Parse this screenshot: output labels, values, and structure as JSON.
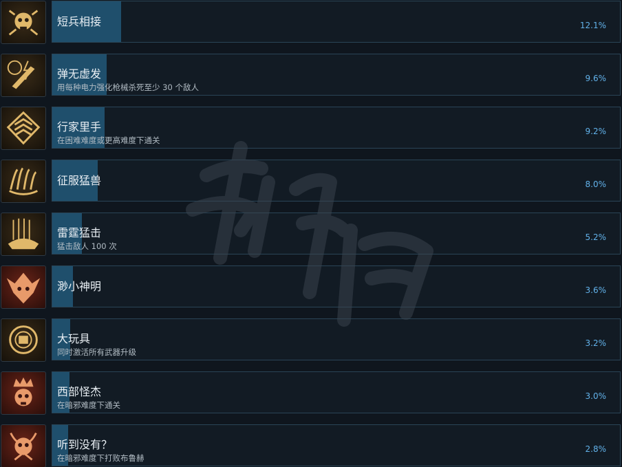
{
  "achievements": [
    {
      "title": "短兵相接",
      "desc": "",
      "percent": "12.1%",
      "fill": 12.1,
      "icon": "skull-crest-icon",
      "theme": "gold"
    },
    {
      "title": "弹无虚发",
      "desc": "用每种电力强化枪械杀死至少 30 个敌人",
      "percent": "9.6%",
      "fill": 9.6,
      "icon": "bullet-lightning-icon",
      "theme": "gold"
    },
    {
      "title": "行家里手",
      "desc": "在困难难度或更高难度下通关",
      "percent": "9.2%",
      "fill": 9.2,
      "icon": "rank-chevron-icon",
      "theme": "gold"
    },
    {
      "title": "征服猛兽",
      "desc": "",
      "percent": "8.0%",
      "fill": 8.0,
      "icon": "beast-claw-icon",
      "theme": "gold"
    },
    {
      "title": "雷霆猛击",
      "desc": "猛击敌人 100 次",
      "percent": "5.2%",
      "fill": 5.2,
      "icon": "thunder-fist-icon",
      "theme": "gold"
    },
    {
      "title": "渺小神明",
      "desc": "",
      "percent": "3.6%",
      "fill": 3.6,
      "icon": "demon-mask-icon",
      "theme": "red"
    },
    {
      "title": "大玩具",
      "desc": "同时激活所有武器升级",
      "percent": "3.2%",
      "fill": 3.2,
      "icon": "weapon-gear-icon",
      "theme": "gold"
    },
    {
      "title": "西部怪杰",
      "desc": "在暗邪难度下通关",
      "percent": "3.0%",
      "fill": 3.0,
      "icon": "crowned-skull-icon",
      "theme": "red"
    },
    {
      "title": "听到没有？",
      "desc": "在暗邪难度下打败布鲁赫",
      "percent": "2.8%",
      "fill": 2.8,
      "icon": "horned-skull-icon",
      "theme": "red"
    }
  ],
  "colors": {
    "bar_fill": "#1f4f6c",
    "percent_text": "#62b2ea",
    "gold_icon": "#e0b86a",
    "red_icon": "#e89a6a"
  }
}
